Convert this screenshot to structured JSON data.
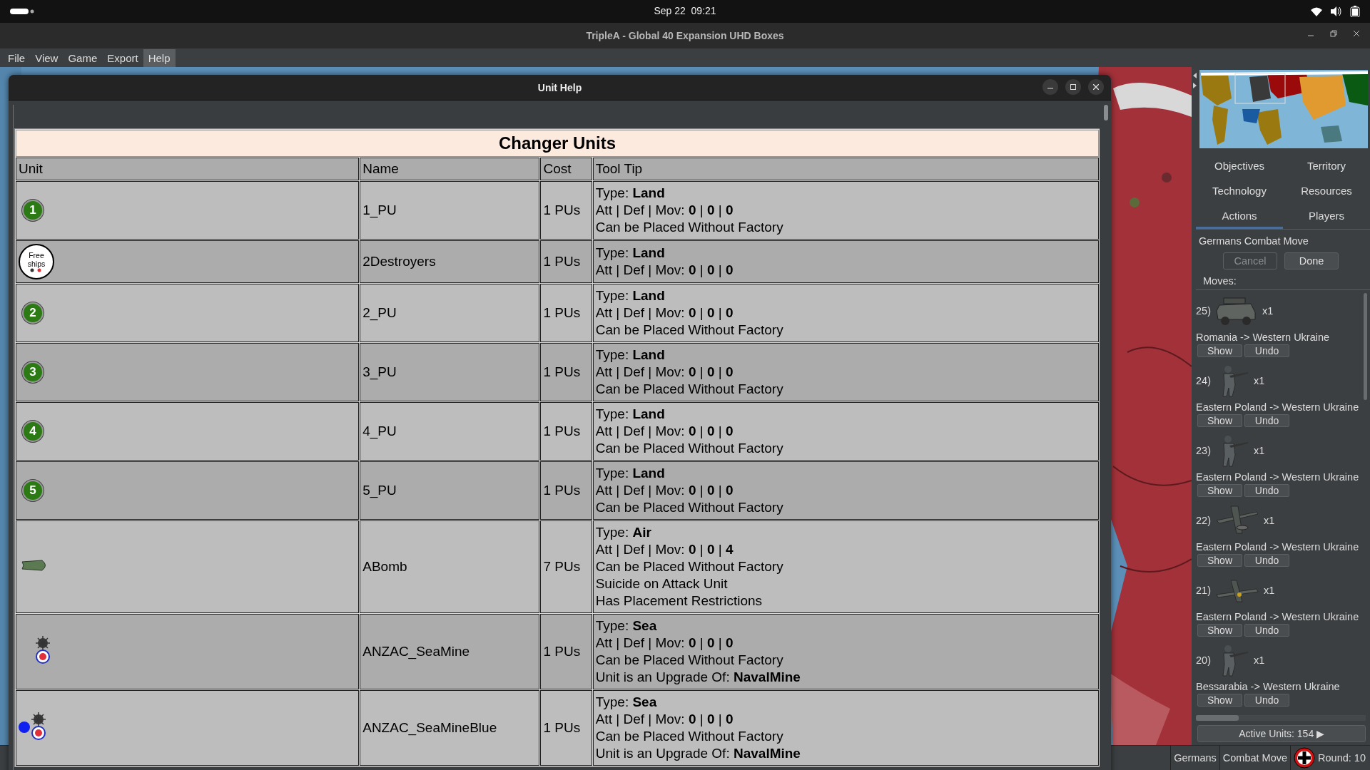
{
  "system_bar": {
    "clock": "Sep 22  09:21"
  },
  "window": {
    "title": "TripleA - Global 40 Expansion UHD Boxes"
  },
  "menu": [
    {
      "label": "File",
      "selected": false
    },
    {
      "label": "View",
      "selected": false
    },
    {
      "label": "Game",
      "selected": false
    },
    {
      "label": "Export",
      "selected": false
    },
    {
      "label": "Help",
      "selected": true
    }
  ],
  "unit_help": {
    "title": "Unit Help",
    "table": {
      "caption": "Changer Units",
      "columns": [
        "Unit",
        "Name",
        "Cost",
        "Tool Tip"
      ],
      "rows": [
        {
          "unit": {
            "kind": "token",
            "label": "1"
          },
          "name": "1_PU",
          "cost": "1 PUs",
          "tooltip": [
            "Type: **Land**",
            "Att | Def | Mov: **0** | **0** | **0**",
            "Can be Placed Without Factory"
          ]
        },
        {
          "unit": {
            "kind": "free-ships",
            "label": "Free ships"
          },
          "name": "2Destroyers",
          "cost": "1 PUs",
          "tooltip": [
            "Type: **Land**",
            "Att | Def | Mov: **0** | **0** | **0**"
          ]
        },
        {
          "unit": {
            "kind": "token",
            "label": "2"
          },
          "name": "2_PU",
          "cost": "1 PUs",
          "tooltip": [
            "Type: **Land**",
            "Att | Def | Mov: **0** | **0** | **0**",
            "Can be Placed Without Factory"
          ]
        },
        {
          "unit": {
            "kind": "token",
            "label": "3"
          },
          "name": "3_PU",
          "cost": "1 PUs",
          "tooltip": [
            "Type: **Land**",
            "Att | Def | Mov: **0** | **0** | **0**",
            "Can be Placed Without Factory"
          ]
        },
        {
          "unit": {
            "kind": "token",
            "label": "4"
          },
          "name": "4_PU",
          "cost": "1 PUs",
          "tooltip": [
            "Type: **Land**",
            "Att | Def | Mov: **0** | **0** | **0**",
            "Can be Placed Without Factory"
          ]
        },
        {
          "unit": {
            "kind": "token",
            "label": "5"
          },
          "name": "5_PU",
          "cost": "1 PUs",
          "tooltip": [
            "Type: **Land**",
            "Att | Def | Mov: **0** | **0** | **0**",
            "Can be Placed Without Factory"
          ]
        },
        {
          "unit": {
            "kind": "bomb"
          },
          "name": "ABomb",
          "cost": "7 PUs",
          "tooltip": [
            "Type: **Air**",
            "Att | Def | Mov: **0** | **0** | **4**",
            "Can be Placed Without Factory",
            "Suicide on Attack Unit",
            "Has Placement Restrictions"
          ]
        },
        {
          "unit": {
            "kind": "seamine"
          },
          "name": "ANZAC_SeaMine",
          "cost": "1 PUs",
          "tooltip": [
            "Type: **Sea**",
            "Att | Def | Mov: **0** | **0** | **0**",
            "Can be Placed Without Factory",
            "Unit is an Upgrade Of: **NavalMine**"
          ]
        },
        {
          "unit": {
            "kind": "seamine-blue"
          },
          "name": "ANZAC_SeaMineBlue",
          "cost": "1 PUs",
          "tooltip": [
            "Type: **Sea**",
            "Att | Def | Mov: **0** | **0** | **0**",
            "Can be Placed Without Factory",
            "Unit is an Upgrade Of: **NavalMine**"
          ]
        }
      ]
    }
  },
  "side_panel": {
    "tabs": [
      {
        "label": "Objectives",
        "selected": false
      },
      {
        "label": "Territory",
        "selected": false
      },
      {
        "label": "Technology",
        "selected": false
      },
      {
        "label": "Resources",
        "selected": false
      },
      {
        "label": "Actions",
        "selected": true
      },
      {
        "label": "Players",
        "selected": false
      }
    ],
    "phase": "Germans Combat Move",
    "buttons": [
      {
        "label": "Cancel",
        "disabled": true
      },
      {
        "label": "Done",
        "disabled": false
      }
    ],
    "moves_label": "Moves:",
    "moves": [
      {
        "number": "25)",
        "unit": {
          "kind": "halftrack",
          "count": "x1"
        },
        "route": "Romania -> Western Ukraine",
        "actions": [
          "Show",
          "Undo"
        ]
      },
      {
        "number": "24)",
        "unit": {
          "kind": "infantry",
          "count": "x1"
        },
        "route": "Eastern Poland -> Western Ukraine",
        "actions": [
          "Show",
          "Undo"
        ]
      },
      {
        "number": "23)",
        "unit": {
          "kind": "infantry",
          "count": "x1"
        },
        "route": "Eastern Poland -> Western Ukraine",
        "actions": [
          "Show",
          "Undo"
        ]
      },
      {
        "number": "22)",
        "unit": {
          "kind": "bomber",
          "count": "x1"
        },
        "route": "Eastern Poland -> Western Ukraine",
        "actions": [
          "Show",
          "Undo"
        ]
      },
      {
        "number": "21)",
        "unit": {
          "kind": "fighter",
          "count": "x1"
        },
        "route": "Eastern Poland -> Western Ukraine",
        "actions": [
          "Show",
          "Undo"
        ]
      },
      {
        "number": "20)",
        "unit": {
          "kind": "infantry",
          "count": "x1"
        },
        "route": "Bessarabia -> Western Ukraine",
        "actions": [
          "Show",
          "Undo"
        ]
      }
    ],
    "active_units": "Active Units: 154 ▶"
  },
  "status_bar": {
    "player": "Germans",
    "phase": "Combat Move",
    "round": "Round: 10"
  }
}
